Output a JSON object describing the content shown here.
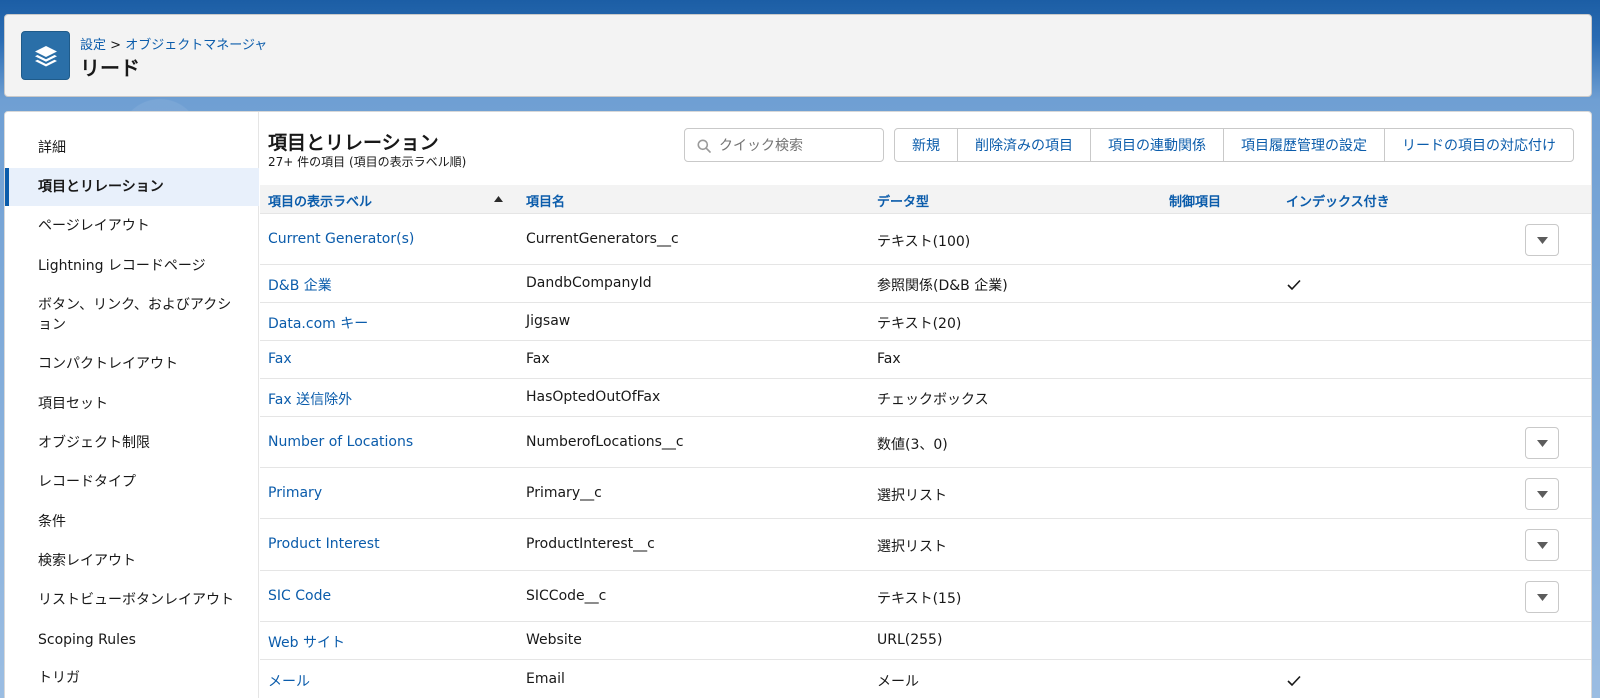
{
  "header": {
    "breadcrumb_setup": "設定",
    "breadcrumb_sep": ">",
    "breadcrumb_object_manager": "オブジェクトマネージャ",
    "title": "リード"
  },
  "sidebar": {
    "items": [
      {
        "label": "詳細"
      },
      {
        "label": "項目とリレーション"
      },
      {
        "label": "ページレイアウト"
      },
      {
        "label": "Lightning レコードページ"
      },
      {
        "label": "ボタン、リンク、およびアクション"
      },
      {
        "label": "コンパクトレイアウト"
      },
      {
        "label": "項目セット"
      },
      {
        "label": "オブジェクト制限"
      },
      {
        "label": "レコードタイプ"
      },
      {
        "label": "条件"
      },
      {
        "label": "検索レイアウト"
      },
      {
        "label": "リストビューボタンレイアウト"
      },
      {
        "label": "Scoping Rules"
      },
      {
        "label": "トリガ"
      }
    ],
    "active": "項目とリレーション"
  },
  "section": {
    "title": "項目とリレーション",
    "subtitle": "27+ 件の項目 (項目の表示ラベル順)"
  },
  "search": {
    "placeholder": "クイック検索",
    "value": ""
  },
  "toolbar": {
    "new": "新規",
    "deleted_fields": "削除済みの項目",
    "field_dependencies": "項目の連動関係",
    "history_tracking": "項目履歴管理の設定",
    "lead_mapping": "リードの項目の対応付け"
  },
  "table": {
    "columns": {
      "label": "項目の表示ラベル",
      "api_name": "項目名",
      "data_type": "データ型",
      "controlling": "制御項目",
      "indexed": "インデックス付き"
    },
    "sort": "ascending",
    "rows": [
      {
        "label": "Current Generator(s)",
        "api_name": "CurrentGenerators__c",
        "data_type": "テキスト(100)",
        "controlling": "",
        "indexed": "",
        "has_menu": true
      },
      {
        "label": "D&B 企業",
        "api_name": "DandbCompanyId",
        "data_type": "参照関係(D&B 企業)",
        "controlling": "",
        "indexed": "✓",
        "has_menu": false
      },
      {
        "label": "Data.com キー",
        "api_name": "Jigsaw",
        "data_type": "テキスト(20)",
        "controlling": "",
        "indexed": "",
        "has_menu": false
      },
      {
        "label": "Fax",
        "api_name": "Fax",
        "data_type": "Fax",
        "controlling": "",
        "indexed": "",
        "has_menu": false
      },
      {
        "label": "Fax 送信除外",
        "api_name": "HasOptedOutOfFax",
        "data_type": "チェックボックス",
        "controlling": "",
        "indexed": "",
        "has_menu": false
      },
      {
        "label": "Number of Locations",
        "api_name": "NumberofLocations__c",
        "data_type": "数値(3、0)",
        "controlling": "",
        "indexed": "",
        "has_menu": true
      },
      {
        "label": "Primary",
        "api_name": "Primary__c",
        "data_type": "選択リスト",
        "controlling": "",
        "indexed": "",
        "has_menu": true
      },
      {
        "label": "Product Interest",
        "api_name": "ProductInterest__c",
        "data_type": "選択リスト",
        "controlling": "",
        "indexed": "",
        "has_menu": true
      },
      {
        "label": "SIC Code",
        "api_name": "SICCode__c",
        "data_type": "テキスト(15)",
        "controlling": "",
        "indexed": "",
        "has_menu": true
      },
      {
        "label": "Web サイト",
        "api_name": "Website",
        "data_type": "URL(255)",
        "controlling": "",
        "indexed": "",
        "has_menu": false
      },
      {
        "label": "メール",
        "api_name": "Email",
        "data_type": "メール",
        "controlling": "",
        "indexed": "✓",
        "has_menu": false
      }
    ]
  },
  "colors": {
    "link": "#0b5cab",
    "brand_icon": "#2a6fa8",
    "header_bg": "#f3f3f3",
    "active_nav_bg": "#e8f0fb"
  },
  "icons": {
    "object": "layers-icon",
    "search": "search-icon",
    "sort": "sort-ascending-icon",
    "row_menu": "chevron-down-icon",
    "indexed": "check-icon"
  }
}
